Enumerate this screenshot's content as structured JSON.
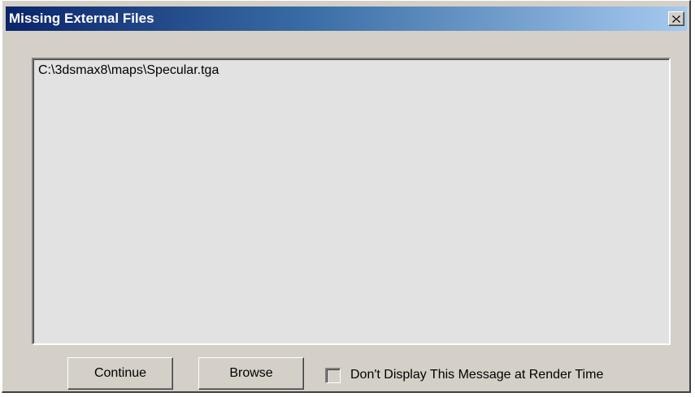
{
  "window": {
    "title": "Missing External Files",
    "close_icon": "close-x-icon"
  },
  "file_list": {
    "items": [
      "C:\\3dsmax8\\maps\\Specular.tga"
    ]
  },
  "buttons": {
    "continue_label": "Continue",
    "browse_label": "Browse"
  },
  "option": {
    "label": "Don't Display This Message at Render Time",
    "checked": false
  },
  "colors": {
    "titlebar_start": "#0a246a",
    "titlebar_end": "#a6caf0",
    "dialog_face": "#d4d0c8",
    "list_background": "#e2e2e2"
  }
}
